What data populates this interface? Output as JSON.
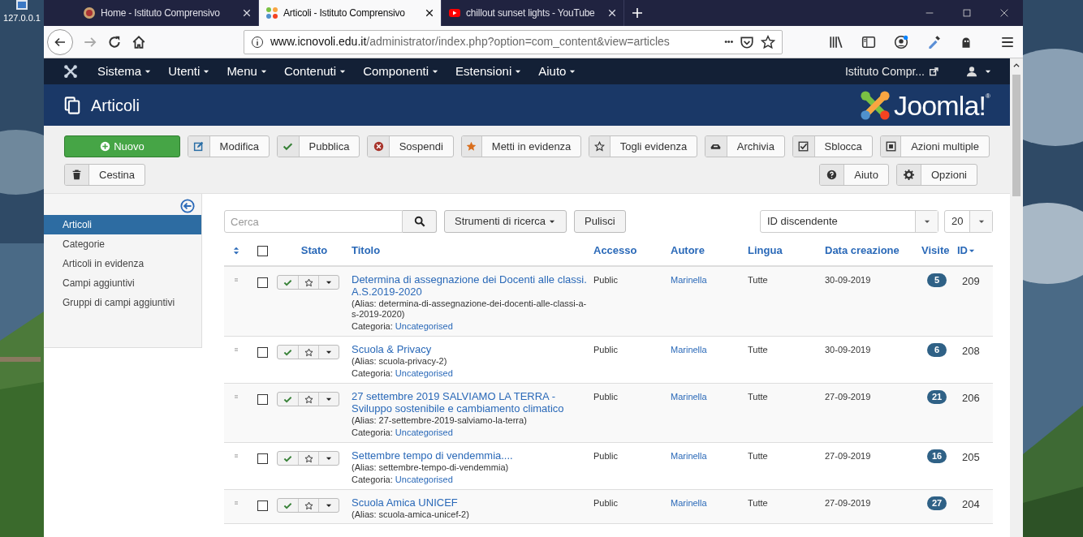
{
  "desktop": {
    "icon_label": "127.0.0.1"
  },
  "browser": {
    "tabs": [
      {
        "title": "Home - Istituto Comprensivo",
        "kind": "crest",
        "selected": false
      },
      {
        "title": "Articoli - Istituto Comprensivo",
        "kind": "joomla",
        "selected": true
      },
      {
        "title": "chillout sunset lights - YouTube",
        "kind": "video",
        "selected": false
      }
    ],
    "url_domain": "www.icnovoli.edu.it",
    "url_path": "/administrator/index.php?option=com_content&view=articles",
    "more": "•••"
  },
  "admin_menu": {
    "items": [
      "Sistema",
      "Utenti",
      "Menu",
      "Contenuti",
      "Componenti",
      "Estensioni",
      "Aiuto"
    ],
    "site_link": "Istituto Compr..."
  },
  "header": {
    "title": "Articoli",
    "logo_text": "Joomla!",
    "logo_mark": "®"
  },
  "toolbar": {
    "buttons": [
      {
        "label": "Nuovo",
        "kind": "new"
      },
      {
        "label": "Modifica",
        "kind": "edit"
      },
      {
        "label": "Pubblica",
        "kind": "publish"
      },
      {
        "label": "Sospendi",
        "kind": "unpublish"
      },
      {
        "label": "Metti in evidenza",
        "kind": "feature"
      },
      {
        "label": "Togli evidenza",
        "kind": "unfeature"
      },
      {
        "label": "Archivia",
        "kind": "archive"
      },
      {
        "label": "Sblocca",
        "kind": "checkin"
      },
      {
        "label": "Azioni multiple",
        "kind": "batch"
      },
      {
        "label": "Cestina",
        "kind": "trash"
      }
    ],
    "right_buttons": [
      {
        "label": "Aiuto",
        "kind": "help"
      },
      {
        "label": "Opzioni",
        "kind": "options"
      }
    ]
  },
  "sidebar": {
    "items": [
      {
        "label": "Articoli",
        "selected": true
      },
      {
        "label": "Categorie",
        "selected": false
      },
      {
        "label": "Articoli in evidenza",
        "selected": false
      },
      {
        "label": "Campi aggiuntivi",
        "selected": false
      },
      {
        "label": "Gruppi di campi aggiuntivi",
        "selected": false
      }
    ]
  },
  "filters": {
    "search_placeholder": "Cerca",
    "search_tools": "Strumenti di ricerca",
    "clear": "Pulisci",
    "ordering": "ID discendente",
    "limit": "20"
  },
  "table": {
    "select_all_checked": false,
    "columns": [
      "Stato",
      "Titolo",
      "Accesso",
      "Autore",
      "Lingua",
      "Data creazione",
      "Visite",
      "ID"
    ],
    "rows": [
      {
        "checked": false,
        "published": true,
        "featured": false,
        "title": "Determina di assegnazione dei Docenti alle classi. A.S.2019-2020",
        "alias": "(Alias: determina-di-assegnazione-dei-docenti-alle-classi-a-s-2019-2020)",
        "category_label": "Categoria:",
        "category": "Uncategorised",
        "access": "Public",
        "author": "Marinella",
        "language": "Tutte",
        "created": "30-09-2019",
        "hits": "5",
        "id": "209"
      },
      {
        "checked": false,
        "published": true,
        "featured": false,
        "title": "Scuola & Privacy",
        "alias": "(Alias: scuola-privacy-2)",
        "category_label": "Categoria:",
        "category": "Uncategorised",
        "access": "Public",
        "author": "Marinella",
        "language": "Tutte",
        "created": "30-09-2019",
        "hits": "6",
        "id": "208"
      },
      {
        "checked": false,
        "published": true,
        "featured": false,
        "title": "27 settembre 2019 SALVIAMO LA TERRA - Sviluppo sostenibile e cambiamento climatico",
        "alias": "(Alias: 27-settembre-2019-salviamo-la-terra)",
        "category_label": "Categoria:",
        "category": "Uncategorised",
        "access": "Public",
        "author": "Marinella",
        "language": "Tutte",
        "created": "27-09-2019",
        "hits": "21",
        "id": "206"
      },
      {
        "checked": false,
        "published": true,
        "featured": false,
        "title": "Settembre tempo di vendemmia....",
        "alias": "(Alias: settembre-tempo-di-vendemmia)",
        "category_label": "Categoria:",
        "category": "Uncategorised",
        "access": "Public",
        "author": "Marinella",
        "language": "Tutte",
        "created": "27-09-2019",
        "hits": "16",
        "id": "205"
      },
      {
        "checked": false,
        "published": true,
        "featured": false,
        "title": "Scuola Amica UNICEF",
        "alias": "(Alias: scuola-amica-unicef-2)",
        "access": "Public",
        "author": "Marinella",
        "language": "Tutte",
        "created": "27-09-2019",
        "hits": "27",
        "id": "204"
      }
    ]
  }
}
